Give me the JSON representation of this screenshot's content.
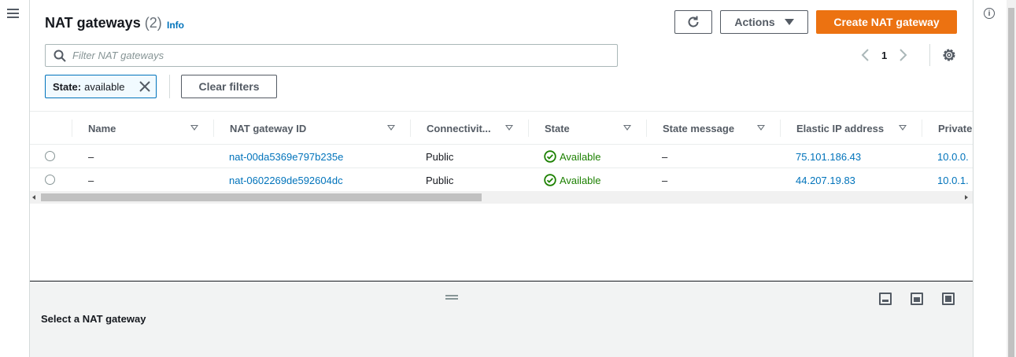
{
  "header": {
    "title": "NAT gateways",
    "count": "(2)",
    "info_label": "Info",
    "actions_label": "Actions",
    "create_label": "Create NAT gateway"
  },
  "search": {
    "placeholder": "Filter NAT gateways"
  },
  "pagination": {
    "current_page": "1"
  },
  "filters": {
    "token_key": "State:",
    "token_value": "available",
    "clear_label": "Clear filters"
  },
  "table": {
    "columns": [
      "Name",
      "NAT gateway ID",
      "Connectivit...",
      "State",
      "State message",
      "Elastic IP address",
      "Private"
    ],
    "rows": [
      {
        "name": "–",
        "id": "nat-00da5369e797b235e",
        "connectivity": "Public",
        "state": "Available",
        "message": "–",
        "eip": "75.101.186.43",
        "private": "10.0.0."
      },
      {
        "name": "–",
        "id": "nat-0602269de592604dc",
        "connectivity": "Public",
        "state": "Available",
        "message": "–",
        "eip": "44.207.19.83",
        "private": "10.0.1."
      }
    ]
  },
  "detail": {
    "placeholder": "Select a NAT gateway"
  },
  "icons": {
    "menu": "hamburger-icon",
    "refresh": "refresh-icon",
    "search": "search-icon",
    "settings": "gear-icon",
    "info": "info-icon",
    "state_ok": "check-circle-icon"
  },
  "colors": {
    "primary": "#ec7211",
    "link": "#0073bb",
    "success": "#1d8102"
  }
}
